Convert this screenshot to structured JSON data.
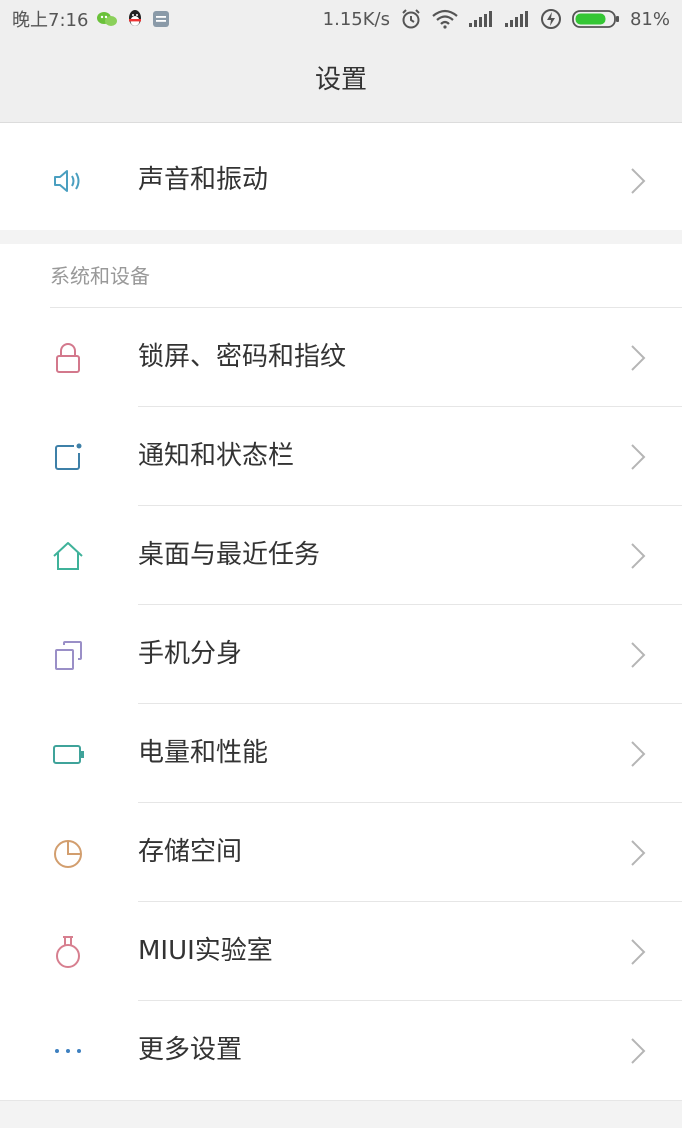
{
  "status_bar": {
    "time": "晚上7:16",
    "network_speed": "1.15K/s",
    "battery_percent": "81%",
    "battery_level": 0.81,
    "icons_left": [
      "wechat-icon",
      "qq-icon",
      "message-icon"
    ],
    "icons_right": [
      "alarm-icon",
      "wifi-icon",
      "signal-icon",
      "signal-icon",
      "charging-icon",
      "battery-icon"
    ]
  },
  "header": {
    "title": "设置"
  },
  "top_item": {
    "label": "声音和振动",
    "icon": "speaker-icon",
    "icon_color": "#4a9fc0"
  },
  "section": {
    "title": "系统和设备",
    "items": [
      {
        "label": "锁屏、密码和指纹",
        "icon": "lock-icon",
        "icon_color": "#d3788c"
      },
      {
        "label": "通知和状态栏",
        "icon": "notification-icon",
        "icon_color": "#3e80a8"
      },
      {
        "label": "桌面与最近任务",
        "icon": "home-icon",
        "icon_color": "#3fb29a"
      },
      {
        "label": "手机分身",
        "icon": "dual-app-icon",
        "icon_color": "#9a8fc7"
      },
      {
        "label": "电量和性能",
        "icon": "battery-icon",
        "icon_color": "#3fa39a"
      },
      {
        "label": "存储空间",
        "icon": "storage-pie-icon",
        "icon_color": "#d29e6e"
      },
      {
        "label": "MIUI实验室",
        "icon": "flask-icon",
        "icon_color": "#d77f8f"
      },
      {
        "label": "更多设置",
        "icon": "more-dots-icon",
        "icon_color": "#3e80c0"
      }
    ]
  },
  "colors": {
    "chevron": "#b5b5b5",
    "battery_green": "#34c634"
  }
}
